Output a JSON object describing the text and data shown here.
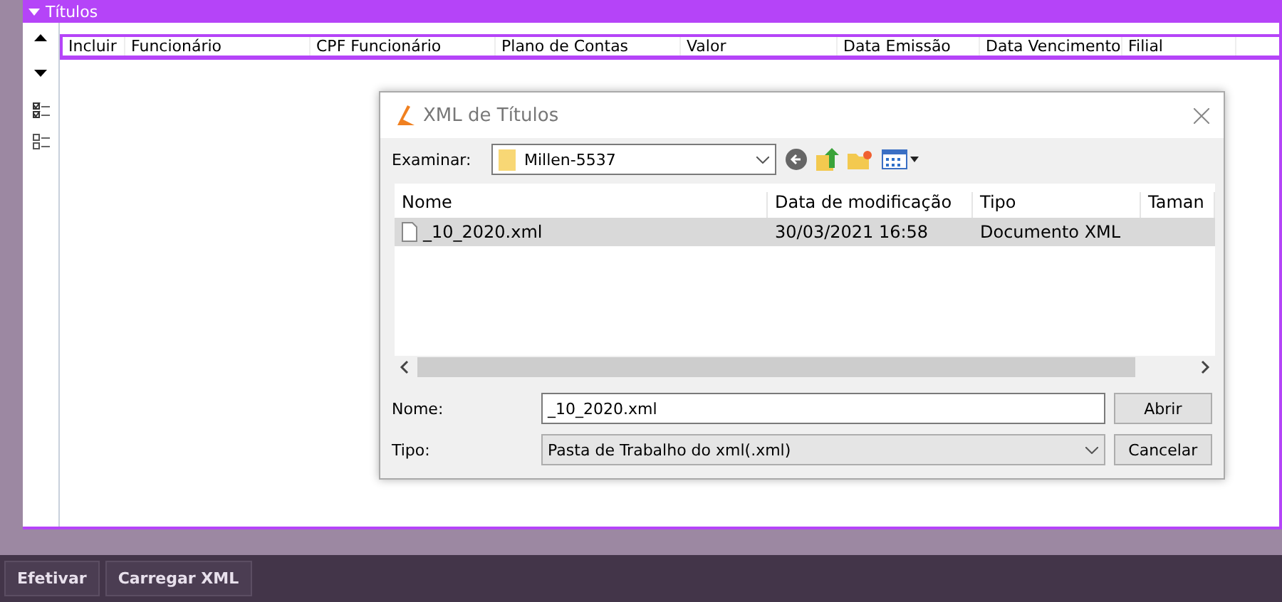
{
  "panel": {
    "title": "Títulos",
    "expanded": true
  },
  "table": {
    "columns": [
      "Incluir",
      "Funcionário",
      "CPF Funcionário",
      "Plano de Contas",
      "Valor",
      "Data Emissão",
      "Data Vencimento",
      "Filial"
    ]
  },
  "dialog": {
    "title": "XML de Títulos",
    "look_in_label": "Examinar:",
    "look_in_value": "Millen-5537",
    "file_columns": [
      "Nome",
      "Data de modificação",
      "Tipo",
      "Taman"
    ],
    "files": [
      {
        "name": "_10_2020.xml",
        "modified": "30/03/2021 16:58",
        "type": "Documento XML",
        "selected": true
      }
    ],
    "name_label": "Nome:",
    "name_value": "_10_2020.xml",
    "type_label": "Tipo:",
    "type_value": "Pasta de Trabalho do xml(.xml)",
    "buttons": [
      "Abrir",
      "Cancelar"
    ]
  },
  "footer_buttons": [
    "Efetivar",
    "Carregar XML"
  ]
}
